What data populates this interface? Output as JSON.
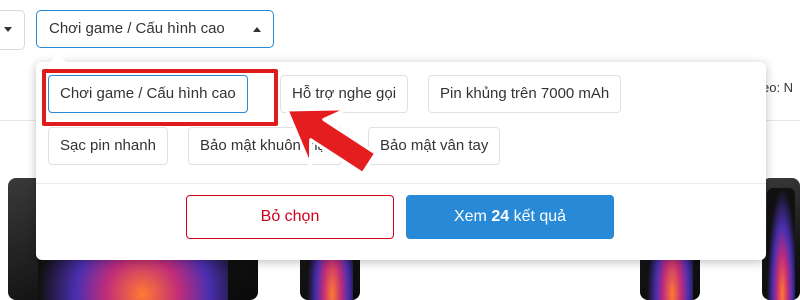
{
  "filter": {
    "selected_label": "Chơi game / Cấu hình cao",
    "sort_label": "eo: N"
  },
  "dropdown": {
    "chips": [
      {
        "label": "Chơi game / Cấu hình cao",
        "selected": true
      },
      {
        "label": "Hỗ trợ nghe gọi",
        "selected": false
      },
      {
        "label": "Pin khủng trên 7000 mAh",
        "selected": false
      },
      {
        "label": "Sạc pin nhanh",
        "selected": false
      },
      {
        "label": "Bảo mật khuôn mặt",
        "selected": false
      },
      {
        "label": "Bảo mật vân tay",
        "selected": false
      }
    ],
    "clear_label": "Bỏ chọn",
    "view_prefix": "Xem",
    "view_count": "24",
    "view_suffix": "kết quả"
  },
  "colors": {
    "accent": "#288ad6",
    "clear_red": "#d0021b",
    "highlight_red": "#e01b1b"
  },
  "icons": [
    "caret-down-icon",
    "caret-up-icon",
    "red-pointer-arrow"
  ]
}
